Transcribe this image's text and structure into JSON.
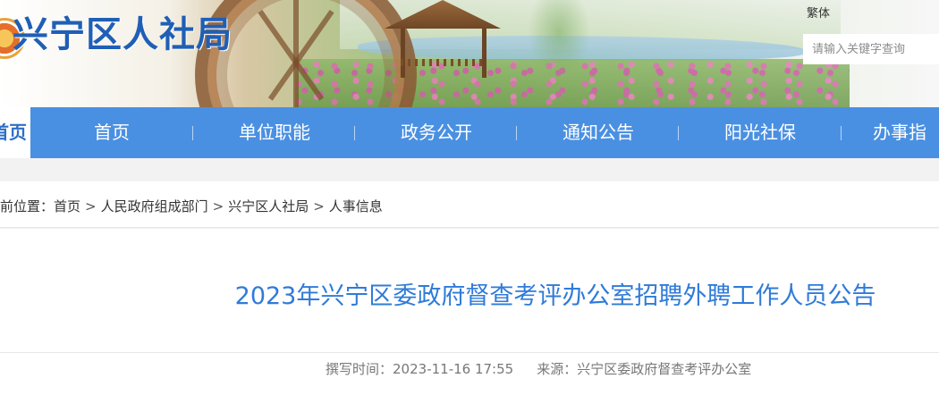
{
  "header": {
    "site_title": "兴宁区人社局",
    "lang_link": "繁体",
    "search_placeholder": "请输入关键字查询"
  },
  "nav": {
    "items": [
      {
        "label": "首页"
      },
      {
        "label": "首页"
      },
      {
        "label": "单位职能"
      },
      {
        "label": "政务公开"
      },
      {
        "label": "通知公告"
      },
      {
        "label": "阳光社保"
      },
      {
        "label": "办事指"
      }
    ]
  },
  "breadcrumb": {
    "prefix": "前位置：",
    "items": [
      "首页",
      "人民政府组成部门",
      "兴宁区人社局",
      "人事信息"
    ],
    "separator": ">"
  },
  "article": {
    "title": "2023年兴宁区委政府督查考评办公室招聘外聘工作人员公告",
    "written_label": "撰写时间：",
    "written_time": "2023-11-16 17:55",
    "source_label": "来源：",
    "source": "兴宁区委政府督查考评办公室"
  },
  "colors": {
    "nav_bg": "#4a90e2",
    "title_blue": "#2f7bd9",
    "logo_blue": "#1f5fb6"
  }
}
